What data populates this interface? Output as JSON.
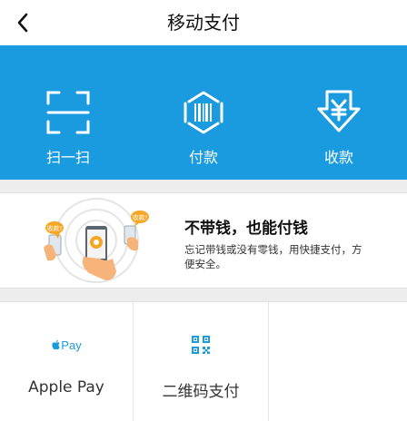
{
  "header": {
    "title": "移动支付",
    "back_icon": "chevron-left-icon"
  },
  "actions": [
    {
      "label": "扫一扫",
      "icon": "scan-icon"
    },
    {
      "label": "付款",
      "icon": "barcode-shield-icon"
    },
    {
      "label": "收款",
      "icon": "yuan-receive-icon"
    }
  ],
  "promo": {
    "title": "不带钱，也能付钱",
    "desc": "忘记带钱或没有零钱，用快捷支付，方便安全。",
    "bubble_left": "收款!",
    "bubble_right": "收款!"
  },
  "methods": [
    {
      "label": "Apple Pay",
      "icon": "apple-pay-icon",
      "icon_text": "Pay"
    },
    {
      "label": "二维码支付",
      "icon": "qr-code-icon"
    },
    {
      "label": "",
      "icon": ""
    }
  ],
  "colors": {
    "accent": "#1a9be0",
    "text": "#111111",
    "divider": "#e2e2e2"
  }
}
